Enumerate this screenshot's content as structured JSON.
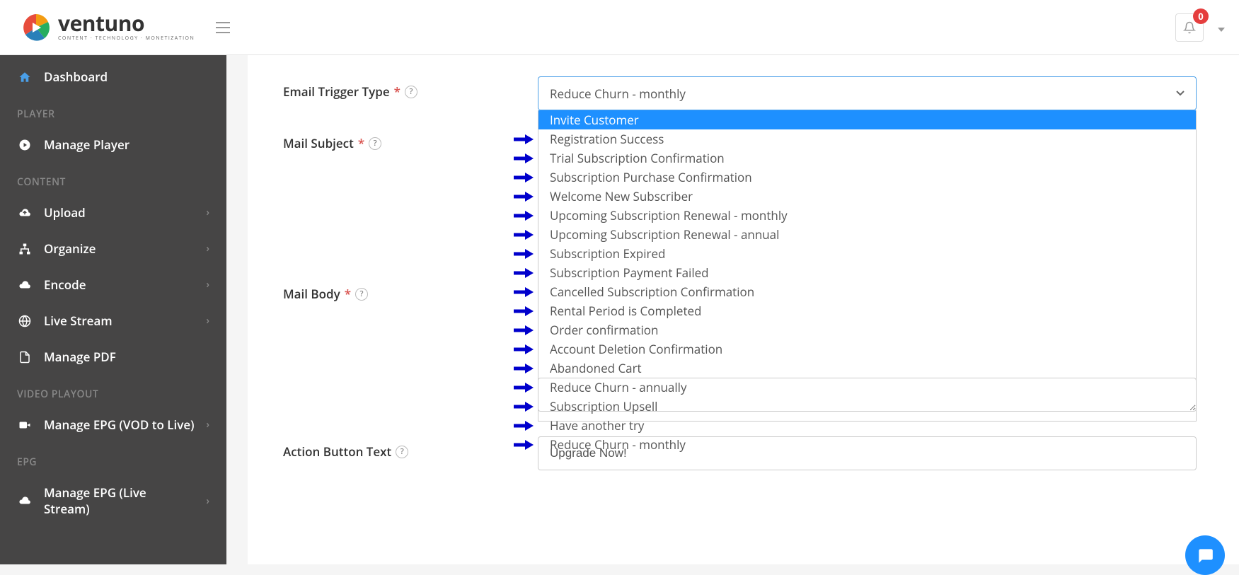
{
  "header": {
    "brand": "ventuno",
    "tagline": "CONTENT · TECHNOLOGY · MONETIZATION",
    "notif_count": "0"
  },
  "sidebar": {
    "dashboard": "Dashboard",
    "sections": {
      "player": "PLAYER",
      "content": "CONTENT",
      "video_playout": "VIDEO PLAYOUT",
      "epg": "EPG"
    },
    "items": {
      "manage_player": "Manage Player",
      "upload": "Upload",
      "organize": "Organize",
      "encode": "Encode",
      "live_stream": "Live Stream",
      "manage_pdf": "Manage PDF",
      "manage_epg_vod": "Manage EPG (VOD to Live)",
      "manage_epg_live": "Manage EPG (Live Stream)"
    }
  },
  "form": {
    "labels": {
      "email_trigger_type": "Email Trigger Type",
      "mail_subject": "Mail Subject",
      "mail_body": "Mail Body",
      "action_button_text": "Action Button Text"
    },
    "selected_trigger": "Reduce Churn - monthly",
    "trigger_options": [
      "Invite Customer",
      "Registration Success",
      "Trial Subscription Confirmation",
      "Subscription Purchase Confirmation",
      "Welcome New Subscriber",
      "Upcoming Subscription Renewal - monthly",
      "Upcoming Subscription Renewal - annual",
      "Subscription Expired",
      "Subscription Payment Failed",
      "Cancelled Subscription Confirmation",
      "Rental Period is Completed",
      "Order confirmation",
      "Account Deletion Confirmation",
      "Abandoned Cart",
      "Reduce Churn - annually",
      "Subscription Upsell",
      "Have another try",
      "Reduce Churn - monthly"
    ],
    "action_button_value": "Upgrade Now!"
  }
}
